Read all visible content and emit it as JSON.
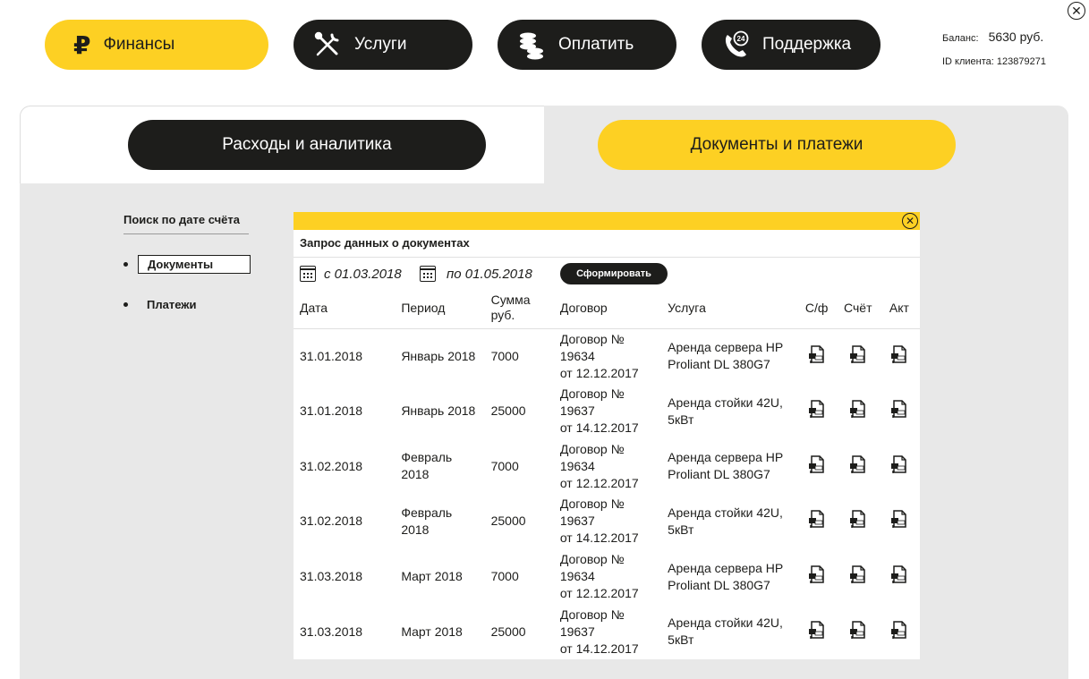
{
  "nav": {
    "finance": "Финансы",
    "finance_icon": "ruble-icon",
    "finance_glyph": "₽",
    "services": "Услуги",
    "pay": "Оплатить",
    "support": "Поддержка"
  },
  "account": {
    "balance_label": "Баланс:",
    "balance_value": "5630 руб.",
    "client_id": "ID клиента: 123879271"
  },
  "tabs": {
    "analytics": "Расходы и аналитика",
    "documents": "Документы и платежи"
  },
  "sidebar": {
    "title": "Поиск по дате счёта",
    "items": [
      "Документы",
      "Платежи"
    ]
  },
  "card": {
    "title": "Запрос данных о документах",
    "date_from": "с 01.03.2018",
    "date_to": "по 01.05.2018",
    "generate": "Сформировать",
    "columns": {
      "date": "Дата",
      "period": "Период",
      "sum": "Сумма руб.",
      "contract": "Договор",
      "service": "Услуга",
      "invoice_fact": "С/ф",
      "invoice": "Счёт",
      "act": "Акт"
    },
    "rows": [
      {
        "date": "31.01.2018",
        "period": "Январь 2018",
        "sum": "7000",
        "contract_no": "Договор № 19634",
        "contract_date": "от 12.12.2017",
        "service": "Аренда сервера HP Proliant DL 380G7"
      },
      {
        "date": "31.01.2018",
        "period": "Январь 2018",
        "sum": "25000",
        "contract_no": "Договор № 19637",
        "contract_date": "от 14.12.2017",
        "service": "Аренда стойки 42U, 5кВт"
      },
      {
        "date": "31.02.2018",
        "period": "Февраль 2018",
        "sum": "7000",
        "contract_no": "Договор № 19634",
        "contract_date": "от 12.12.2017",
        "service": "Аренда сервера HP Proliant DL 380G7"
      },
      {
        "date": "31.02.2018",
        "period": "Февраль 2018",
        "sum": "25000",
        "contract_no": "Договор № 19637",
        "contract_date": "от 14.12.2017",
        "service": "Аренда стойки 42U, 5кВт"
      },
      {
        "date": "31.03.2018",
        "period": "Март 2018",
        "sum": "7000",
        "contract_no": "Договор № 19634",
        "contract_date": "от 12.12.2017",
        "service": "Аренда сервера HP Proliant DL 380G7"
      },
      {
        "date": "31.03.2018",
        "period": "Март 2018",
        "sum": "25000",
        "contract_no": "Договор № 19637",
        "contract_date": "от 14.12.2017",
        "service": "Аренда стойки 42U, 5кВт"
      }
    ]
  },
  "colors": {
    "accent": "#fdd023",
    "dark": "#1d1d1b",
    "panel": "#e8e8e8"
  }
}
